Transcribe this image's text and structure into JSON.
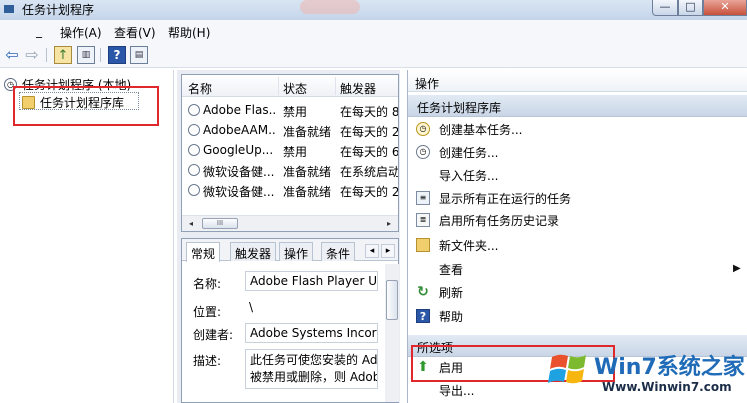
{
  "window": {
    "title": "任务计划程序",
    "controls": {
      "minimize": "—",
      "maximize": "□",
      "close": "✕"
    }
  },
  "menu": {
    "file_stub": "_",
    "items": [
      "操作(A)",
      "查看(V)",
      "帮助(H)"
    ]
  },
  "toolbar": {
    "icons": [
      "back-arrow-icon",
      "forward-arrow-icon",
      "up-folder-icon",
      "show-pane-icon",
      "help-icon",
      "show-action-pane-icon"
    ],
    "back": "⇦",
    "forward": "⇨",
    "up": "↑",
    "help": "?"
  },
  "tree": {
    "root": "任务计划程序 (本地)",
    "child": "任务计划程序库"
  },
  "task_list": {
    "columns": [
      "名称",
      "状态",
      "触发器"
    ],
    "rows": [
      {
        "name": "Adobe Flas...",
        "status": "禁用",
        "trigger": "在每天的 8"
      },
      {
        "name": "AdobeAAM...",
        "status": "准备就绪",
        "trigger": "在每天的 2"
      },
      {
        "name": "GoogleUp...",
        "status": "禁用",
        "trigger": "在每天的 6"
      },
      {
        "name": "微软设备健...",
        "status": "准备就绪",
        "trigger": "在系统启动"
      },
      {
        "name": "微软设备健...",
        "status": "准备就绪",
        "trigger": "在每天的 2"
      }
    ],
    "scroll_left": "◂",
    "scroll_right": "▸",
    "scroll_thumb": "III"
  },
  "detail": {
    "tabs": [
      "常规",
      "触发器",
      "操作",
      "条件"
    ],
    "tab_prev": "◂",
    "tab_next": "▸",
    "name_label": "名称:",
    "name_value": "Adobe Flash Player Updater",
    "location_label": "位置:",
    "location_value": "\\",
    "author_label": "创建者:",
    "author_value": "Adobe Systems Incorporated",
    "desc_label": "描述:",
    "desc_line1": "此任务可使您安装的 Adobe",
    "desc_line2": "被禁用或删除，则 Adobe"
  },
  "actions": {
    "header": "操作",
    "section1": "任务计划程序库",
    "items": [
      "创建基本任务...",
      "创建任务...",
      "导入任务...",
      "显示所有正在运行的任务",
      "启用所有任务历史记录",
      "新文件夹...",
      "查看",
      "刷新",
      "帮助"
    ],
    "submenu_arrow": "▶",
    "section2": "所选项",
    "selected_items": [
      "启用",
      "导出..."
    ]
  },
  "watermark": {
    "brand": "Win7系统之家",
    "url": "Www.Winwin7.com"
  },
  "colors": {
    "highlight_box": "#e0272c",
    "section_bg": "#c9d6e6",
    "brand_blue": "#1f6bb8"
  }
}
